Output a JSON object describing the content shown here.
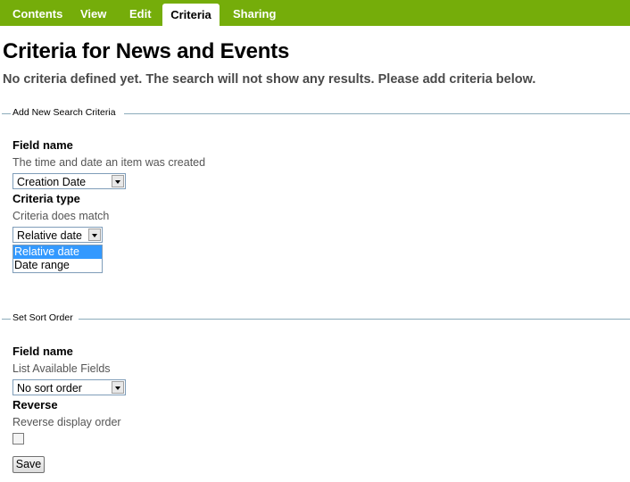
{
  "tabs": [
    {
      "label": "Contents"
    },
    {
      "label": "View"
    },
    {
      "label": "Edit"
    },
    {
      "label": "Criteria",
      "active": true
    },
    {
      "label": "Sharing"
    }
  ],
  "colors": {
    "tabbar": "#75ad0a",
    "legend_line": "#8cacbb",
    "selection": "#3399ff"
  },
  "page": {
    "title": "Criteria for News and Events",
    "subtitle": "No criteria defined yet. The search will not show any results. Please add criteria below."
  },
  "add_criteria": {
    "legend": "Add New Search Criteria",
    "field_label": "Field name",
    "field_help": "The time and date an item was created",
    "field_value": "Creation Date",
    "type_label": "Criteria type",
    "type_help": "Criteria does match",
    "type_value": "Relative date",
    "type_options": [
      {
        "label": "Relative date",
        "highlighted": true
      },
      {
        "label": "Date range",
        "highlighted": false
      }
    ]
  },
  "sort_order": {
    "legend": "Set Sort Order",
    "field_label": "Field name",
    "field_help": "List Available Fields",
    "field_value": "No sort order",
    "reverse_label": "Reverse",
    "reverse_help": "Reverse display order",
    "reverse_checked": false
  },
  "buttons": {
    "save": "Save"
  }
}
